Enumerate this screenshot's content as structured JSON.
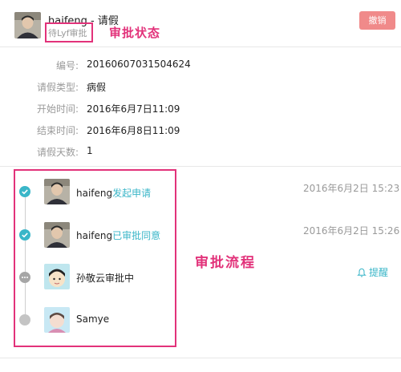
{
  "header": {
    "title": "haifeng - 请假",
    "status": "待Lyf审批",
    "status_annotation": "审批状态",
    "revoke_label": "撤销"
  },
  "details": [
    {
      "label": "编号:",
      "value": "20160607031504624"
    },
    {
      "label": "请假类型:",
      "value": "病假"
    },
    {
      "label": "开始时间:",
      "value": "2016年6月7日11:09"
    },
    {
      "label": "结束时间:",
      "value": "2016年6月8日11:09"
    },
    {
      "label": "请假天数:",
      "value": "1"
    }
  ],
  "flow": {
    "annotation": "审批流程",
    "remind_label": "提醒",
    "steps": [
      {
        "name": "haifeng",
        "action": "发起申请",
        "time": "2016年6月2日 15:23",
        "state": "done"
      },
      {
        "name": "haifeng",
        "action": "已审批同意",
        "time": "2016年6月2日 15:26",
        "state": "done"
      },
      {
        "name": "孙敬云审批中",
        "action": "",
        "time": "",
        "state": "pending"
      },
      {
        "name": "Samye",
        "action": "",
        "time": "",
        "state": "waiting"
      }
    ]
  },
  "colors": {
    "accent": "#3ab6c8",
    "annotation": "#e2327a",
    "revoke_button": "#f08a8a"
  },
  "icons": {
    "done": "check-icon",
    "pending": "ellipsis-icon",
    "waiting": "dot-icon",
    "remind": "bell-icon"
  }
}
